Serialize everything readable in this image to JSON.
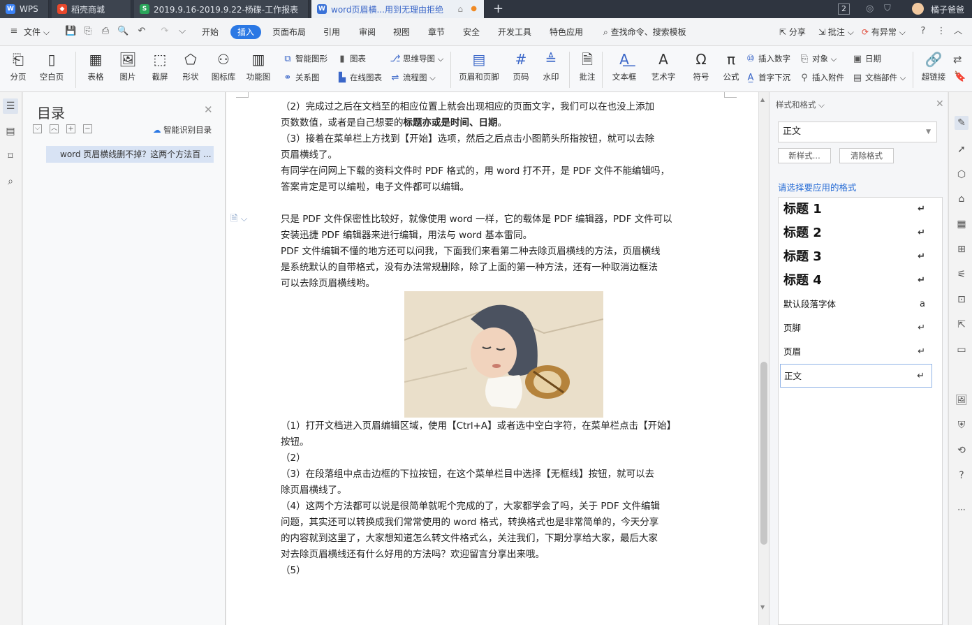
{
  "tabs": [
    {
      "label": "WPS",
      "icon": "wps-logo-icon"
    },
    {
      "label": "稻壳商城",
      "icon": "daoke-icon"
    },
    {
      "label": "2019.9.16-2019.9.22-杨碟-工作报表",
      "icon": "sheet-icon"
    },
    {
      "label": "word页眉横...用到无理由拒绝",
      "icon": "writer-icon"
    }
  ],
  "titlebar": {
    "badge": "2",
    "user": "橘子爸爸"
  },
  "menu": {
    "file": "文件",
    "items": [
      "开始",
      "插入",
      "页面布局",
      "引用",
      "审阅",
      "视图",
      "章节",
      "安全",
      "开发工具",
      "特色应用"
    ],
    "active": "插入",
    "search": "查找命令、搜索模板",
    "share": "分享",
    "comment": "批注",
    "anomaly": "有异常"
  },
  "ribbon": {
    "big": [
      "分页",
      "空白页",
      "表格",
      "图片",
      "截屏",
      "形状",
      "图标库",
      "功能图",
      "页眉和页脚",
      "页码",
      "水印",
      "批注",
      "文本框",
      "艺术字",
      "符号",
      "公式",
      "超链接"
    ],
    "small": {
      "smart_shape": "智能图形",
      "chart": "图表",
      "mindmap": "思维导图",
      "relation": "关系图",
      "online_chart": "在线图表",
      "flowchart": "流程图",
      "insert_number": "插入数字",
      "object": "对象",
      "date": "日期",
      "dropcap": "首字下沉",
      "attachment": "插入附件",
      "doc_parts": "文档部件"
    }
  },
  "toc": {
    "title": "目录",
    "smart": "智能识别目录",
    "entry": "word 页眉横线删不掉？这两个方法百 ..."
  },
  "doc": {
    "lines": [
      {
        "html": "（2）完成过之后在文档至的相应位置上就会出现相应的页面文字，我们可以在也没上添加"
      },
      {
        "html": "页数数值，或者是自己想要的<b>标题亦或是时间、日期</b>。"
      },
      {
        "html": "（3）接着在菜单栏上方找到【开始】选项，然后之后点击小图箭头所指按钮，就可以去除"
      },
      {
        "html": "页眉横线了。"
      },
      {
        "html": "有同学在问网上下载的资料文件时 PDF 格式的，用 word 打不开，是 PDF 文件不能编辑吗，"
      },
      {
        "html": "答案肯定是可以编啦，电子文件都可以编辑。"
      },
      {
        "html": ""
      },
      {
        "html": "只是 PDF 文件保密性比较好，就像使用 word 一样，它的载体是 PDF 编辑器，PDF 文件可以"
      },
      {
        "html": "安装迅捷 PDF 编辑器来进行编辑，用法与 word 基本雷同。"
      },
      {
        "html": "PDF 文件编辑不懂的地方还可以问我，下面我们来看第二种去除页眉横线的方法，页眉横线"
      },
      {
        "html": "是系统默认的自带格式，没有办法常规删除，除了上面的第一种方法，还有一种取消边框法"
      },
      {
        "html": "可以去除页眉横线哟。"
      }
    ],
    "lines2": [
      {
        "html": "（1）打开文档进入页眉编辑区域，使用【Ctrl+A】或者选中空白字符，在菜单栏点击【开始】"
      },
      {
        "html": "按钮。"
      },
      {
        "html": "（2）"
      },
      {
        "html": "（3）在段落组中点击边框的下拉按钮，在这个菜单栏目中选择【无框线】按钮，就可以去"
      },
      {
        "html": "除页眉横线了。"
      },
      {
        "html": "（4）这两个方法都可以说是很简单就呢个完成的了，大家都学会了吗，关于 PDF 文件编辑"
      },
      {
        "html": "问题，其实还可以转换成我们常常使用的 word 格式，转换格式也是非常简单的，今天分享"
      },
      {
        "html": "的内容就到这里了，大家想知道怎么转文件格式么，关注我们，下期分享给大家，最后大家"
      },
      {
        "html": "对去除页眉横线还有什么好用的方法吗？欢迎留言分享出来哦。"
      },
      {
        "html": "（5）"
      }
    ]
  },
  "styles": {
    "header": "样式和格式",
    "current": "正文",
    "new_btn": "新样式...",
    "clear_btn": "清除格式",
    "prompt": "请选择要应用的格式",
    "list": [
      {
        "label": "标题 1",
        "kind": "h"
      },
      {
        "label": "标题 2",
        "kind": "h"
      },
      {
        "label": "标题 3",
        "kind": "h"
      },
      {
        "label": "标题 4",
        "kind": "h"
      },
      {
        "label": "默认段落字体",
        "kind": "a"
      },
      {
        "label": "页脚",
        "kind": "p"
      },
      {
        "label": "页眉",
        "kind": "p"
      },
      {
        "label": "正文",
        "kind": "p"
      }
    ]
  },
  "colors": {
    "accent": "#2b78e4",
    "tabbar": "#2f3540",
    "link": "#2b6fd6"
  }
}
